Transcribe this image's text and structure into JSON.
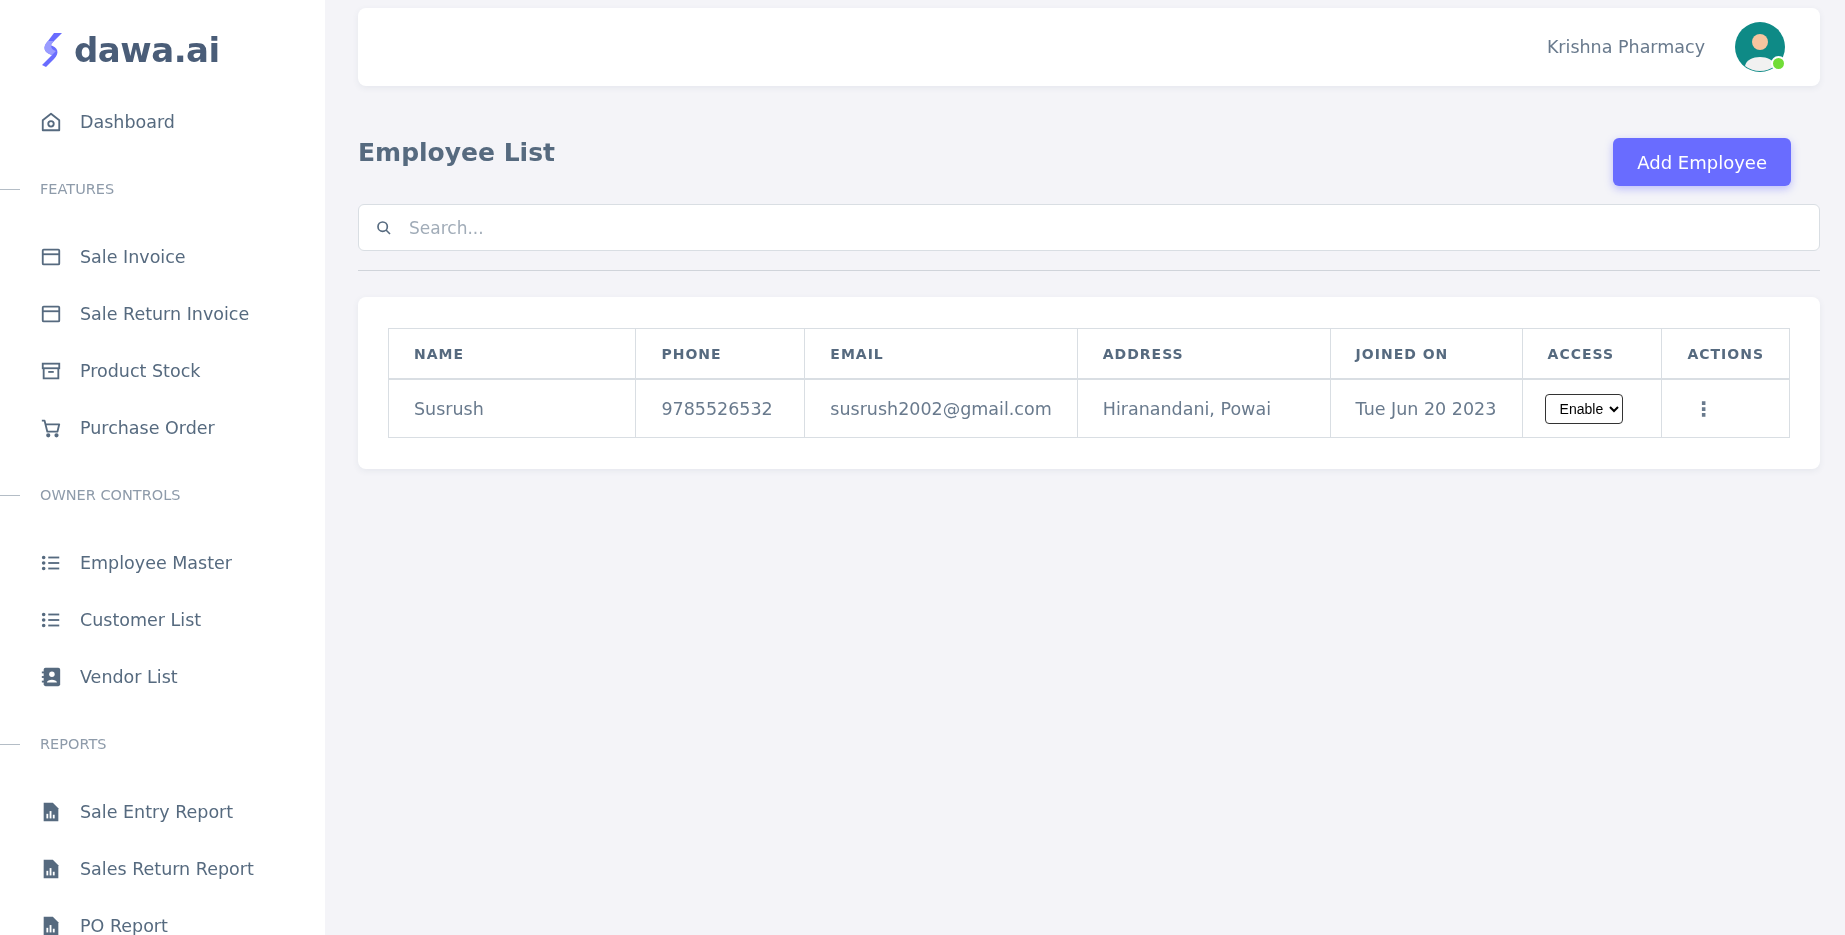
{
  "brand": {
    "name": "dawa.ai"
  },
  "sidebar": {
    "items": [
      {
        "label": "Dashboard",
        "selected": false
      }
    ],
    "sections": [
      {
        "title": "FEATURES",
        "items": [
          {
            "label": "Sale Invoice",
            "selected": false
          },
          {
            "label": "Sale Return Invoice",
            "selected": false
          },
          {
            "label": "Product Stock",
            "selected": false
          },
          {
            "label": "Purchase Order",
            "selected": false
          }
        ]
      },
      {
        "title": "OWNER CONTROLS",
        "items": [
          {
            "label": "Employee Master",
            "selected": false
          },
          {
            "label": "Customer List",
            "selected": false
          },
          {
            "label": "Vendor List",
            "selected": false
          }
        ]
      },
      {
        "title": "REPORTS",
        "items": [
          {
            "label": "Sale Entry Report",
            "selected": false
          },
          {
            "label": "Sales Return Report",
            "selected": false
          },
          {
            "label": "PO Report",
            "selected": false
          }
        ]
      }
    ]
  },
  "header": {
    "store_name": "Krishna Pharmacy",
    "online": true
  },
  "page": {
    "title": "Employee List",
    "add_button": "Add Employee",
    "search": {
      "placeholder": "Search..."
    }
  },
  "table": {
    "columns": [
      "NAME",
      "PHONE",
      "EMAIL",
      "ADDRESS",
      "JOINED ON",
      "ACCESS",
      "ACTIONS"
    ],
    "rows": [
      {
        "name": "Susrush",
        "phone": "9785526532",
        "email": "susrush2002@gmail.com",
        "address": "Hiranandani, Powai",
        "joined_on": "Tue Jun 20 2023",
        "access": "Enable",
        "actions": "⋮"
      }
    ]
  }
}
